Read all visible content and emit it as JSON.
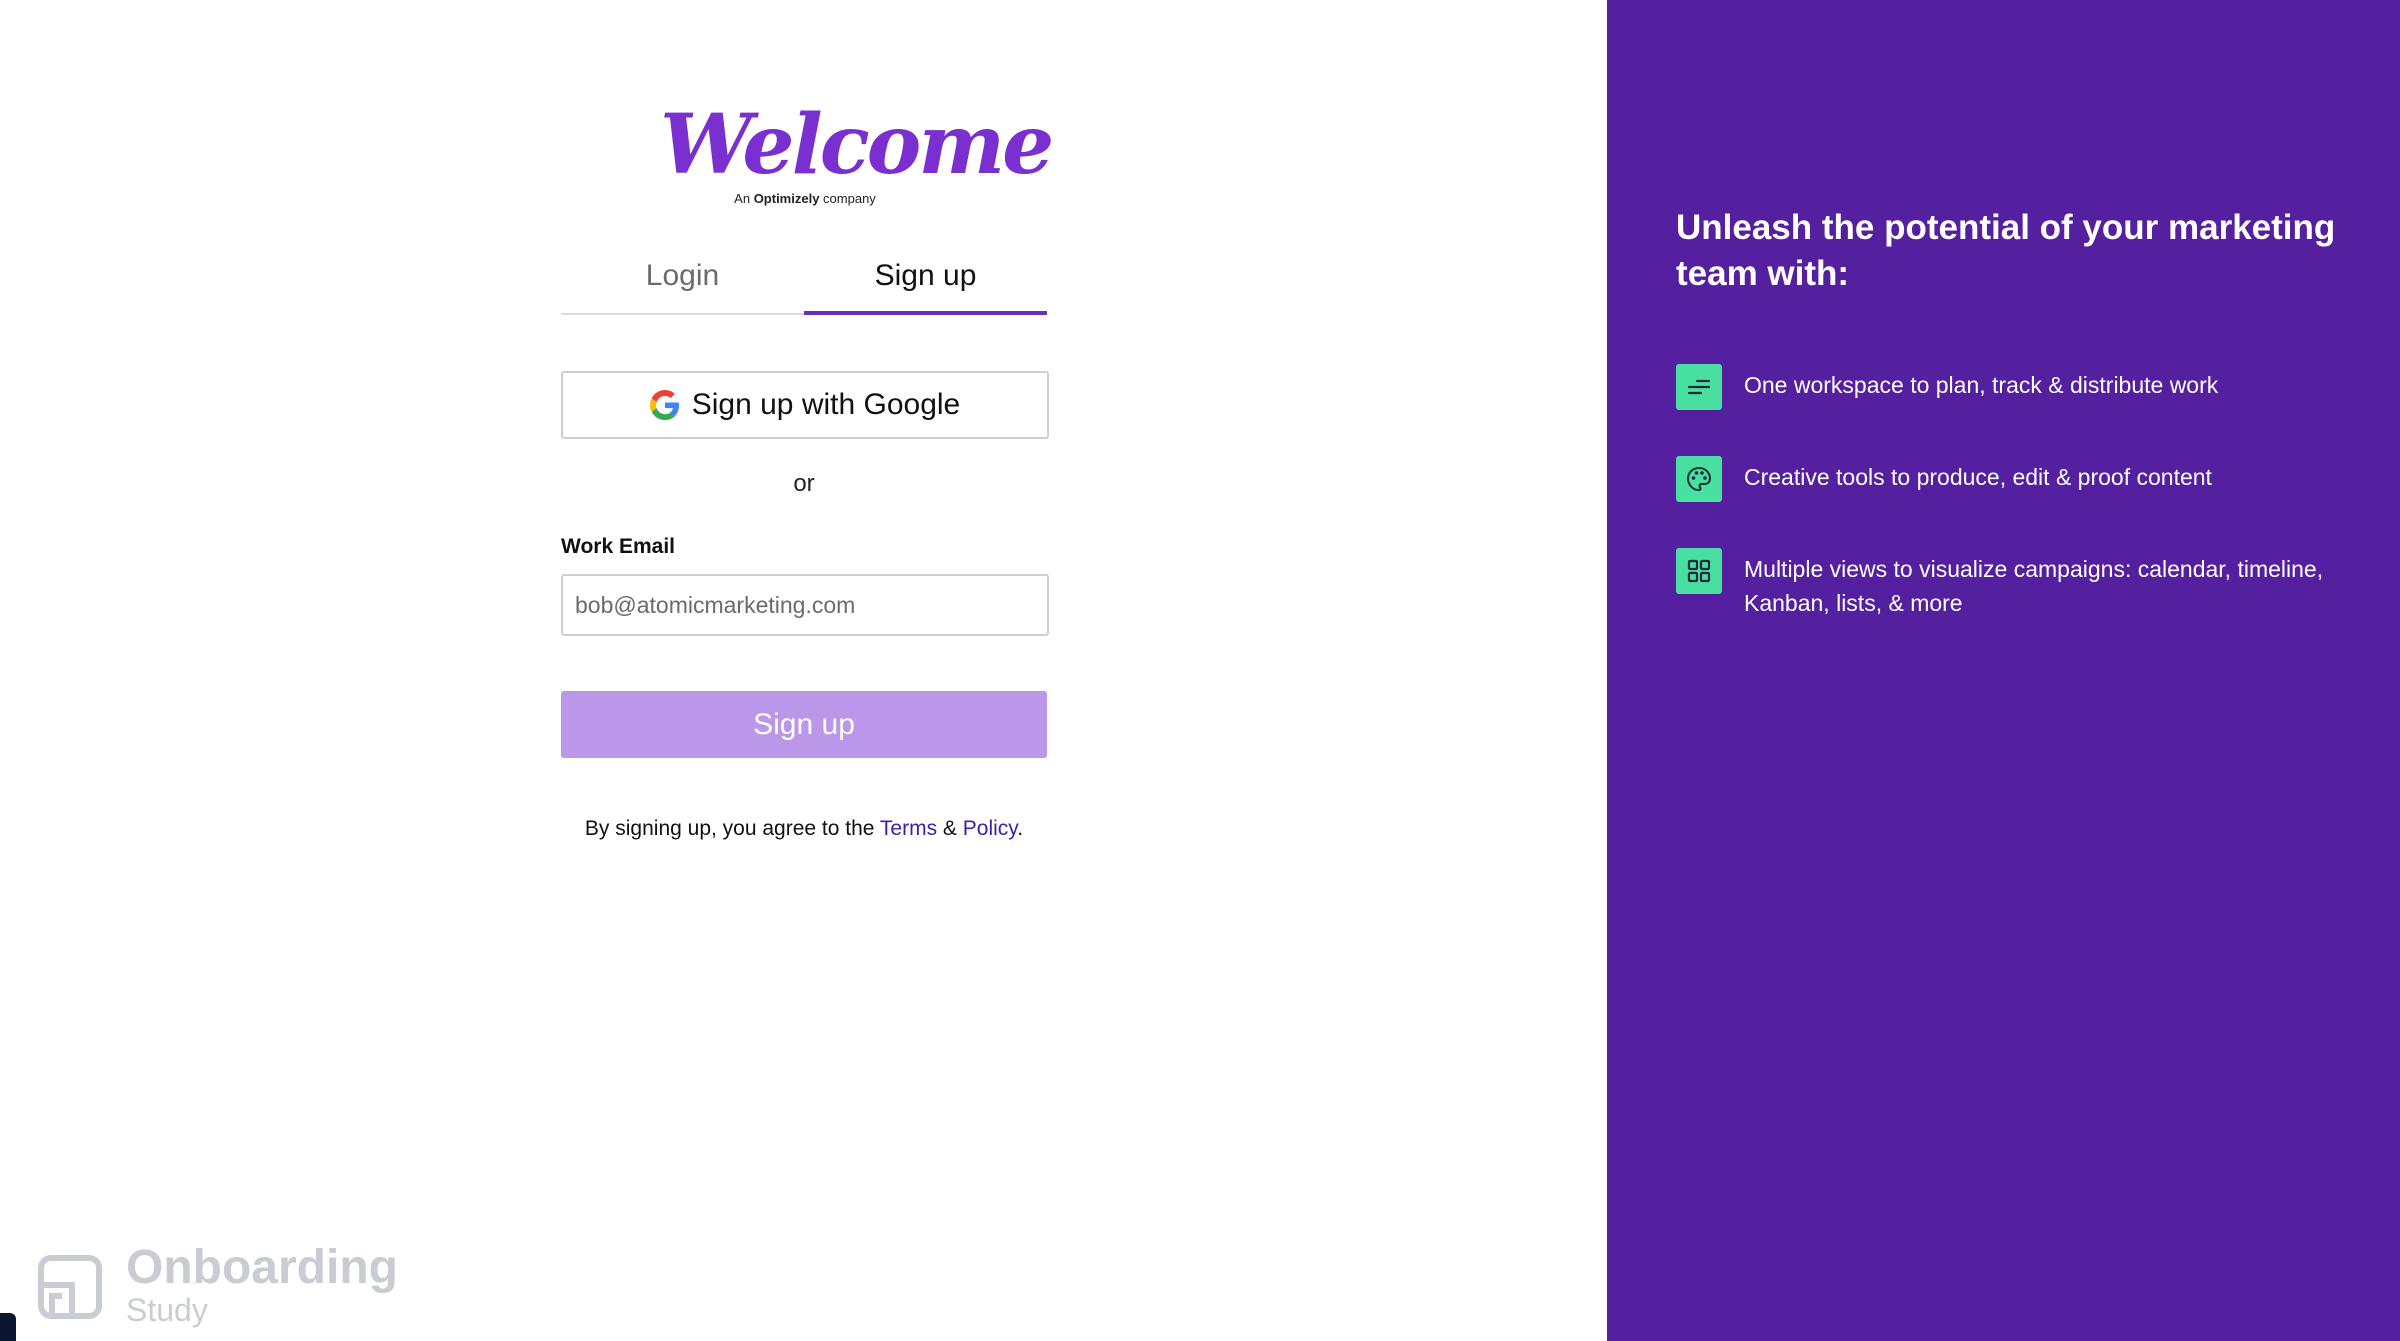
{
  "logo": {
    "wordmark": "Welcome",
    "sub_prefix": "An ",
    "sub_brand": "Optimizely",
    "sub_suffix": " company",
    "color": "#7a2fd0"
  },
  "tabs": [
    {
      "label": "Login",
      "active": false
    },
    {
      "label": "Sign up",
      "active": true
    }
  ],
  "google_button": {
    "label": "Sign up with Google",
    "icon": "google-icon"
  },
  "divider": {
    "label": "or"
  },
  "email": {
    "label": "Work Email",
    "placeholder": "bob@atomicmarketing.com",
    "value": ""
  },
  "submit": {
    "label": "Sign up",
    "color": "#bb97e9"
  },
  "terms": {
    "prefix": "By signing up, you agree to the ",
    "terms_link": "Terms",
    "connector": " & ",
    "policy_link": "Policy",
    "suffix": "."
  },
  "watermark": {
    "title": "Onboarding",
    "subtitle": "Study",
    "icon": "onboarding-study-logo-icon"
  },
  "panel": {
    "background": "#5420a0",
    "headline": "Unleash the potential of your marketing team with:",
    "accent": "#48e0a0",
    "features": [
      {
        "icon": "lines-icon",
        "text": "One workspace to plan, track & distribute work"
      },
      {
        "icon": "palette-icon",
        "text": "Creative tools to produce, edit & proof content"
      },
      {
        "icon": "grid-icon",
        "text": "Multiple views to visualize campaigns: calendar, timeline, Kanban, lists, & more"
      }
    ]
  }
}
